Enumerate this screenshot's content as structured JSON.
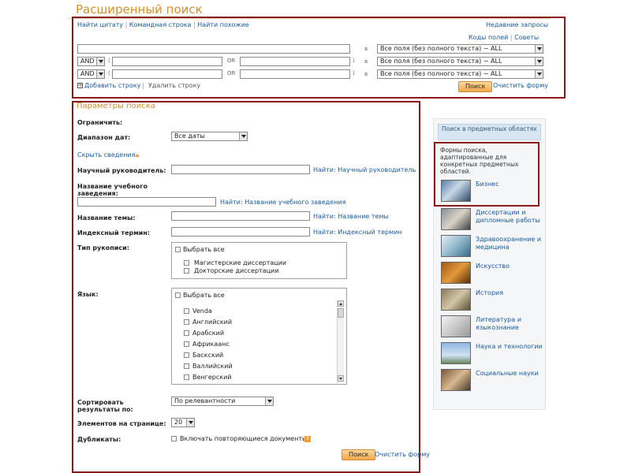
{
  "header": {
    "title": "Расширенный поиск"
  },
  "top_links": {
    "find_citation": "Найти цитату",
    "command_line": "Командная строка",
    "find_similar": "Найти похожие",
    "separator": "|",
    "recent_queries": "Недавние запросы",
    "field_codes": "Коды полей",
    "tips": "Советы"
  },
  "search_rows": {
    "field_select": "Все поля (без полного текста) − ALL",
    "operator": "AND",
    "or_label": "OR",
    "in_label": "в",
    "open_paren": "(",
    "close_paren": ")",
    "values": [
      "",
      "",
      "",
      "",
      ""
    ]
  },
  "row_actions": {
    "add_row": "Добавить строку",
    "remove_row": "Удалить строку",
    "search_button": "Поиск",
    "clear_form": "Очистить форму"
  },
  "params": {
    "section_title": "Параметры поиска",
    "limit_label": "Ограничить:",
    "date_range_label": "Диапазон дат:",
    "date_range_value": "Все даты",
    "hide_details": "Скрыть сведения",
    "advisor_label": "Научный руководитель:",
    "advisor_link": "Найти: Научный руководитель",
    "institution_label_1": "Название учебного",
    "institution_label_2": "заведения:",
    "institution_link": "Найти: Название учебного заведения",
    "subject_label": "Название темы:",
    "subject_link": "Найти: Название темы",
    "index_term_label": "Индексный термин:",
    "index_term_link": "Найти: Индексный термин",
    "manuscript_type_label": "Тип рукописи:",
    "select_all": "Выбрать все",
    "manuscript_types": [
      "Магистерские диссертации",
      "Докторские диссертации"
    ],
    "language_label": "Язык:",
    "languages": [
      "Venda",
      "Английский",
      "Арабский",
      "Африкаанс",
      "Баскский",
      "Валлийский",
      "Венгерский"
    ],
    "sort_label_1": "Сортировать",
    "sort_label_2": "результаты по:",
    "sort_value": "По релевантности",
    "per_page_label": "Элементов на странице:",
    "per_page_value": "20",
    "duplicates_label": "Дубликаты:",
    "duplicates_checkbox": "Включать повторяющиеся документы",
    "help_glyph": "!",
    "caret_glyph": "+",
    "search_button": "Поиск",
    "clear_form": "Очистить форму"
  },
  "sidebar": {
    "title": "Поиск в предметных областях",
    "description": "Формы поиска, адаптированные для конкретных предметных областей.",
    "categories": [
      {
        "label": "Бизнес",
        "icon": "business-photo"
      },
      {
        "label": "Диссертации и дипломные работы",
        "icon": "graduate-photo"
      },
      {
        "label": "Здравоохранение и медицина",
        "icon": "medicine-photo"
      },
      {
        "label": "Искусство",
        "icon": "arts-photo"
      },
      {
        "label": "История",
        "icon": "history-photo"
      },
      {
        "label": "Литература и языкознание",
        "icon": "book-photo"
      },
      {
        "label": "Наука и технологии",
        "icon": "wind-turbines-photo"
      },
      {
        "label": "Социальные науки",
        "icon": "people-photo"
      }
    ]
  },
  "colors": {
    "accent_orange": "#d4902b",
    "link_blue": "#1a5aa0",
    "highlight_red": "#8b1a1a"
  }
}
